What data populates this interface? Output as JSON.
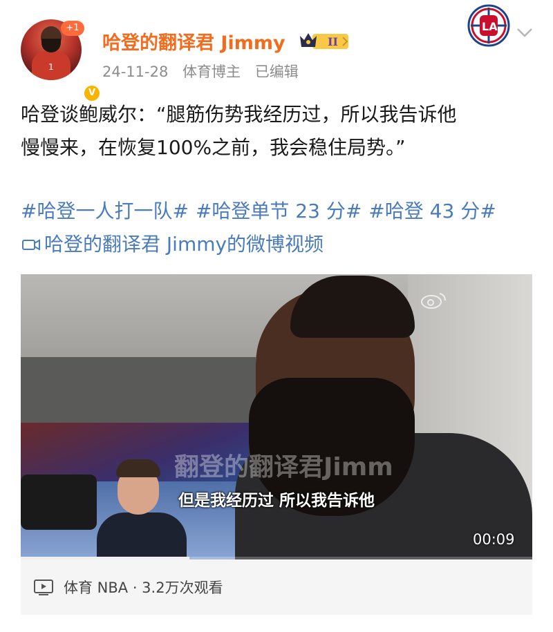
{
  "header": {
    "username": "哈登的翻译君 Jimmy",
    "plus_badge": "+1",
    "level_badge": "II",
    "verified_mark": "V",
    "date": "24-11-28",
    "role": "体育博主",
    "edited": "已编辑"
  },
  "post": {
    "text_line1": "哈登谈鲍威尔：“腿筋伤势我经历过，所以我告诉他",
    "text_line2": "慢慢来，在恢复100%之前，我会稳住局势。”",
    "hashtags": [
      "#哈登一人打一队#",
      "#哈登单节 23 分#",
      "#哈登 43 分#"
    ],
    "video_link": "哈登的翻译君 Jimmy的微博视频"
  },
  "video": {
    "watermark": "翻登的翻译君Jimm",
    "subtitle": "但是我经历过  所以我告诉他",
    "duration": "00:09",
    "progress": 0.33
  },
  "video_info": {
    "category": "体育 NBA · 3.2万次观看"
  },
  "icons": {
    "team_logo": "clippers-logo-icon",
    "chevron": "chevron-down-icon",
    "video": "video-camera-icon",
    "play": "play-icon"
  },
  "colors": {
    "username": "#f06c1f",
    "hashtag": "#4a7bbd",
    "meta": "#8c8c8c",
    "badge_gold": "#f7b500"
  }
}
